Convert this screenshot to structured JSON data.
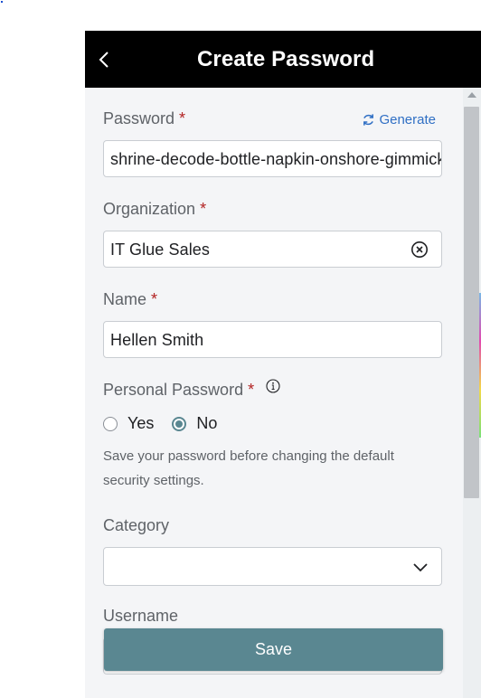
{
  "header": {
    "title": "Create Password"
  },
  "password": {
    "label": "Password",
    "required_mark": "*",
    "value": "shrine-decode-bottle-napkin-onshore-gimmick",
    "generate_label": "Generate"
  },
  "organization": {
    "label": "Organization",
    "required_mark": "*",
    "value": "IT Glue Sales"
  },
  "name": {
    "label": "Name",
    "required_mark": "*",
    "value": "Hellen Smith"
  },
  "personal_password": {
    "label": "Personal Password",
    "required_mark": "*",
    "options": [
      {
        "label": "Yes",
        "selected": false
      },
      {
        "label": "No",
        "selected": true
      }
    ],
    "helper": "Save your password before changing the default security settings."
  },
  "category": {
    "label": "Category",
    "value": ""
  },
  "username": {
    "label": "Username"
  },
  "actions": {
    "save_label": "Save"
  },
  "colors": {
    "header_bg": "#000000",
    "accent": "#5a8791",
    "link": "#2f6fc4",
    "required": "#b22222"
  }
}
